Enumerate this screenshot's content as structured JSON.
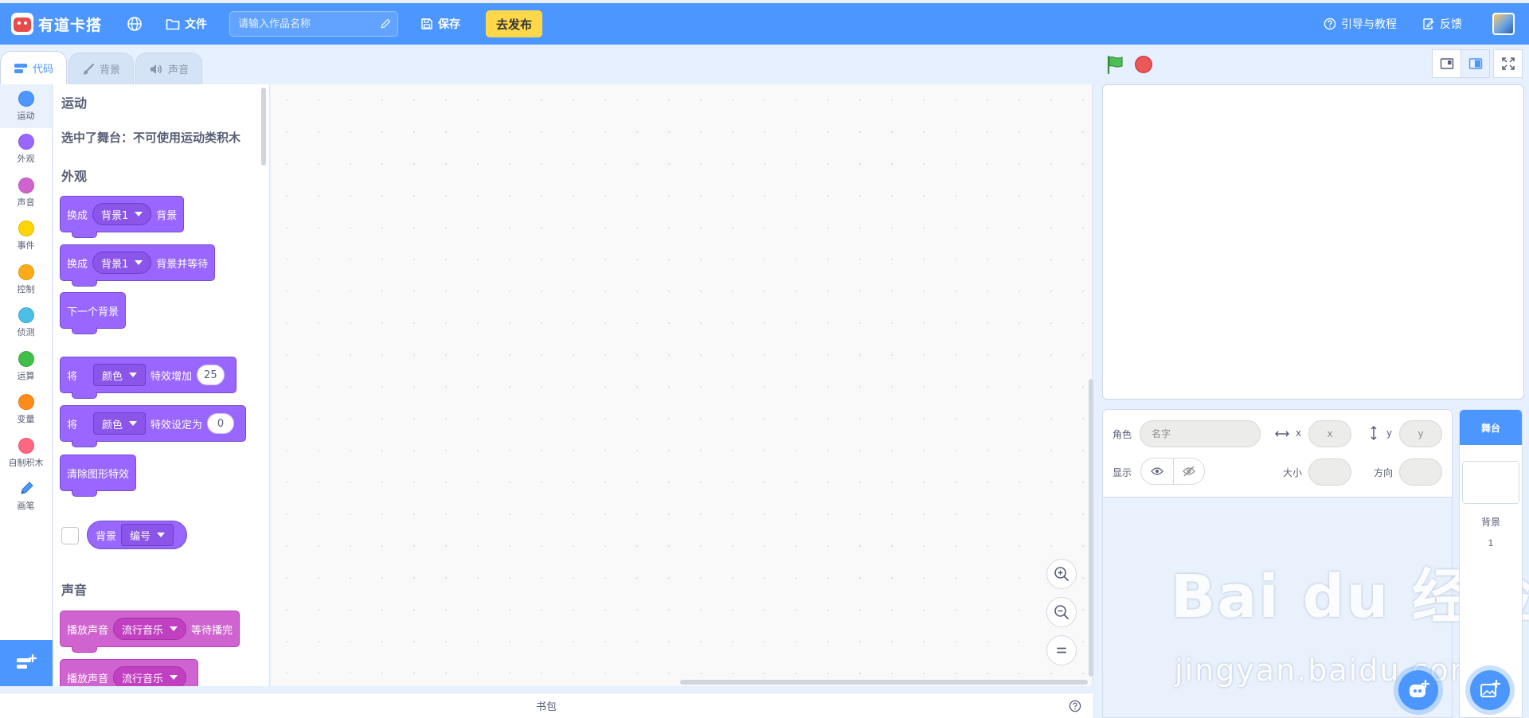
{
  "app": {
    "logo_text": "有道卡搭",
    "file_label": "文件",
    "title_placeholder": "请输入作品名称",
    "save_label": "保存",
    "publish_label": "去发布",
    "guide_label": "引导与教程",
    "feedback_label": "反馈"
  },
  "tabs": [
    {
      "label": "代码",
      "icon": "code-icon",
      "active": true
    },
    {
      "label": "背景",
      "icon": "brush-icon",
      "active": false
    },
    {
      "label": "声音",
      "icon": "speaker-icon",
      "active": false
    }
  ],
  "categories": [
    {
      "label": "运动",
      "color": "#4c97ff"
    },
    {
      "label": "外观",
      "color": "#9966ff"
    },
    {
      "label": "声音",
      "color": "#cf63cf"
    },
    {
      "label": "事件",
      "color": "#ffd500"
    },
    {
      "label": "控制",
      "color": "#ffab19"
    },
    {
      "label": "侦测",
      "color": "#4cbfe6"
    },
    {
      "label": "运算",
      "color": "#40bf4a"
    },
    {
      "label": "变量",
      "color": "#ff8c1a"
    },
    {
      "label": "自制积木",
      "color": "#ff6680"
    },
    {
      "label": "画笔",
      "icon": "pen-icon"
    }
  ],
  "palette": {
    "motion_title": "运动",
    "motion_note": "选中了舞台：不可使用运动类积木",
    "looks_title": "外观",
    "sound_title": "声音",
    "blocks": {
      "switch_backdrop": {
        "prefix": "换成",
        "menu": "背景1",
        "suffix": "背景"
      },
      "switch_backdrop_wait": {
        "prefix": "换成",
        "menu": "背景1",
        "suffix": "背景并等待"
      },
      "next_backdrop": {
        "label": "下一个背景"
      },
      "change_effect": {
        "prefix": "将",
        "menu": "颜色",
        "middle": "特效增加",
        "value": "25"
      },
      "set_effect": {
        "prefix": "将",
        "menu": "颜色",
        "middle": "特效设定为",
        "value": "0"
      },
      "clear_effects": {
        "label": "清除图形特效"
      },
      "backdrop_reporter": {
        "label": "背景",
        "menu": "编号"
      },
      "play_until_done": {
        "prefix": "播放声音",
        "menu": "流行音乐",
        "suffix": "等待播完"
      },
      "play_sound": {
        "prefix": "播放声音",
        "menu": "流行音乐"
      }
    }
  },
  "backpack_label": "书包",
  "sprite_info": {
    "sprite_label": "角色",
    "name_placeholder": "名字",
    "x_label": "x",
    "x_placeholder": "x",
    "y_label": "y",
    "y_placeholder": "y",
    "show_label": "显示",
    "size_label": "大小",
    "direction_label": "方向"
  },
  "stage_panel": {
    "header": "舞台",
    "backdrops_label": "背景",
    "backdrops_count": "1"
  },
  "watermark": {
    "main": "Bai du 经验",
    "sub": "jingyan.baidu.com"
  },
  "colors": {
    "accent": "#4c97ff",
    "publish": "#ffd84a",
    "looks_block": "#9966ff",
    "sound_block": "#cf63cf"
  }
}
